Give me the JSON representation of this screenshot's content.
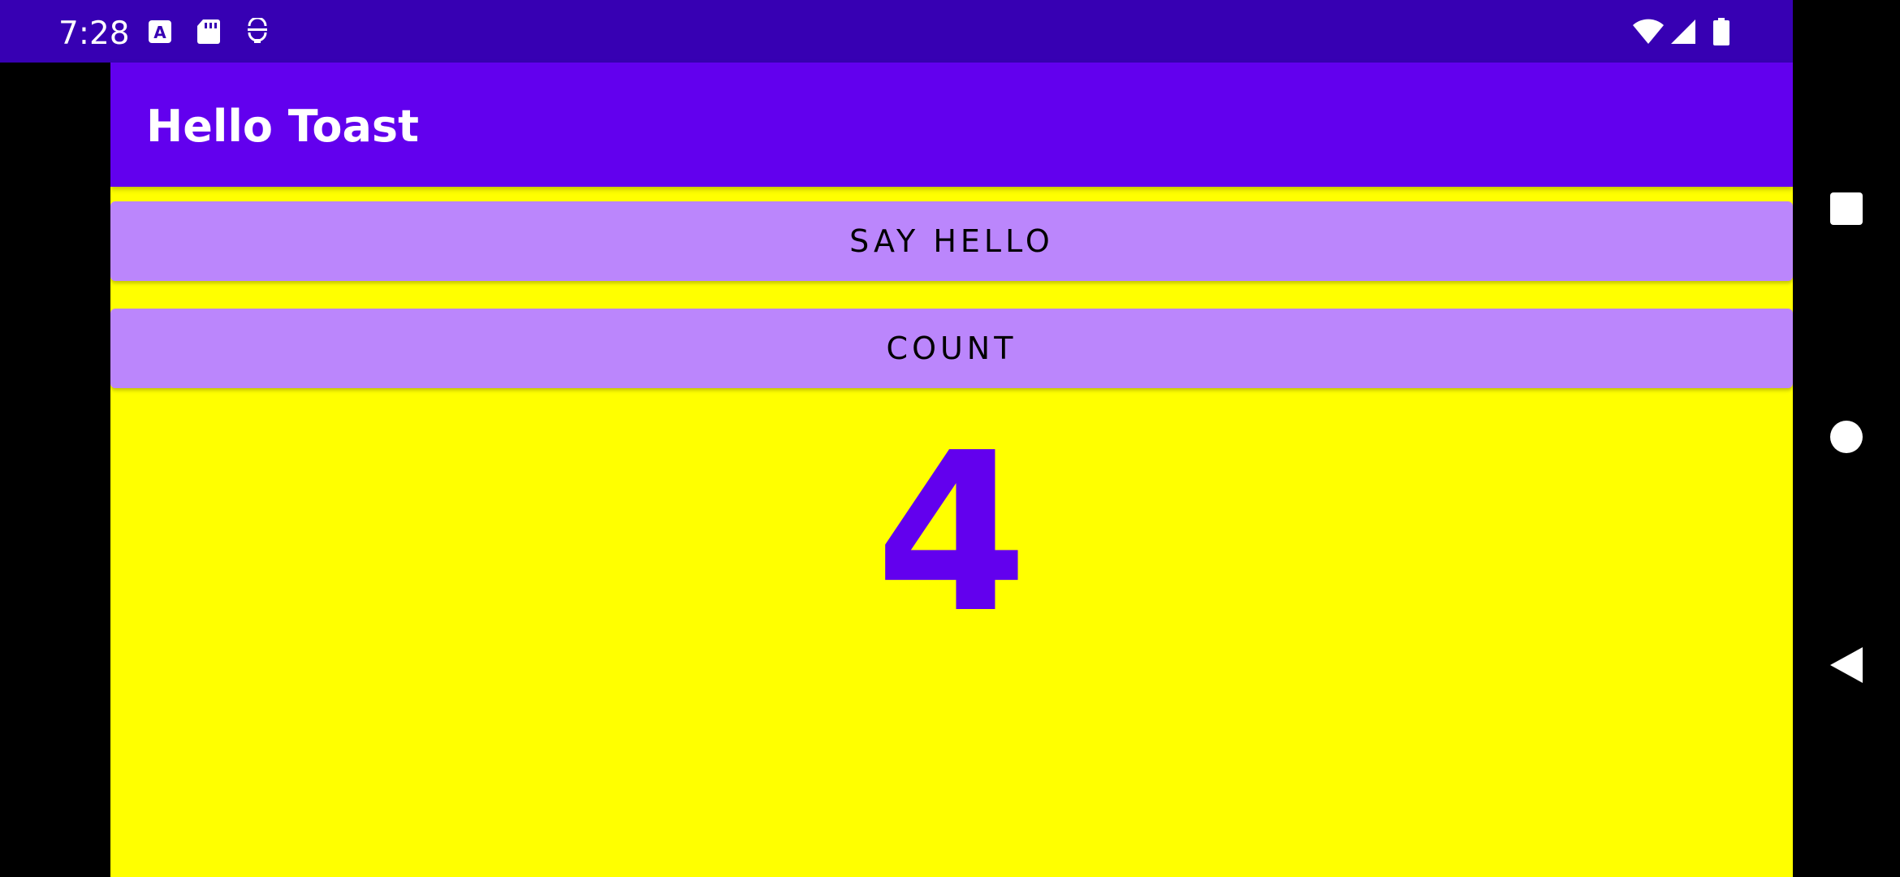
{
  "status_bar": {
    "time": "7:28",
    "left_icons": [
      "font-notification-icon",
      "sd-card-icon",
      "emoji-test-icon"
    ],
    "right_icons": [
      "wifi-icon",
      "cellular-signal-icon",
      "battery-icon"
    ]
  },
  "app_bar": {
    "title": "Hello Toast"
  },
  "buttons": {
    "say_hello_label": "SAY HELLO",
    "count_label": "COUNT"
  },
  "counter": {
    "value": "4"
  },
  "nav_bar": {
    "icons": [
      "recents-square-icon",
      "home-circle-icon",
      "back-triangle-icon"
    ]
  },
  "colors": {
    "status_bar": "#3700b3",
    "app_bar": "#6200ee",
    "background": "#ffff00",
    "button": "#bb86fc",
    "count_text": "#6200ee"
  }
}
